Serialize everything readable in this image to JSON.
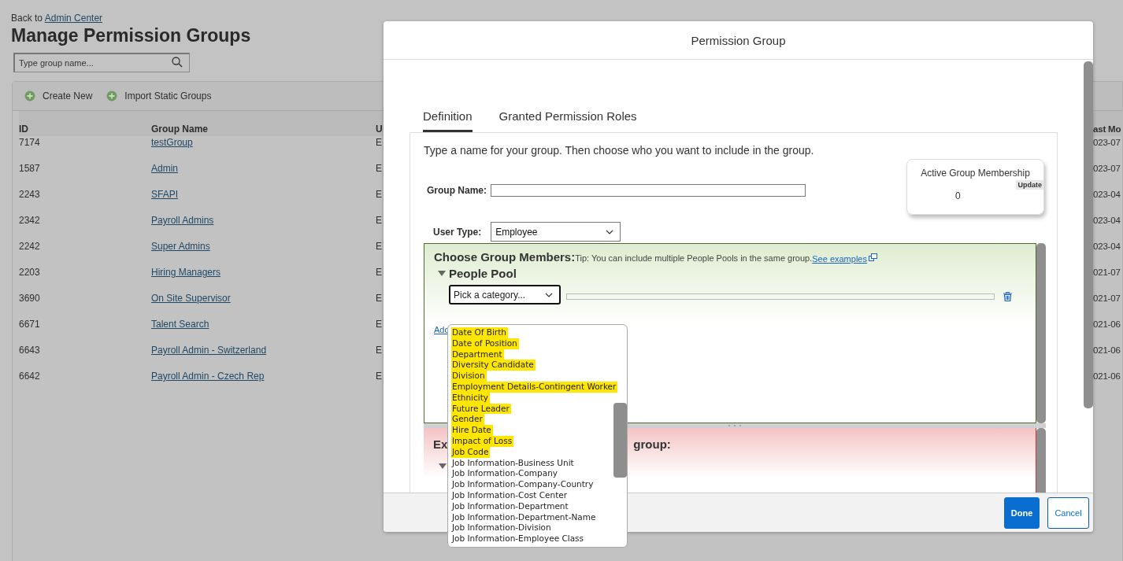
{
  "page": {
    "back_prefix": "Back to",
    "back_link": "Admin Center",
    "title": "Manage Permission Groups",
    "search": {
      "placeholder": "Type group name..."
    },
    "toolbar": [
      "Create New",
      "Import Static Groups"
    ],
    "table": {
      "columns": [
        "ID",
        "Group Name",
        "U",
        "ast Mo"
      ],
      "rows": [
        [
          "7174",
          "testGroup",
          "E",
          "023-07"
        ],
        [
          "1587",
          "Admin",
          "E",
          "023-07"
        ],
        [
          "2243",
          "SFAPI",
          "E",
          "023-04"
        ],
        [
          "2342",
          "Payroll Admins",
          "E",
          "023-04"
        ],
        [
          "2242",
          "Super Admins",
          "E",
          "023-04"
        ],
        [
          "2203",
          "Hiring Managers",
          "E",
          "021-07"
        ],
        [
          "3690",
          "On Site Supervisor",
          "E",
          "021-07"
        ],
        [
          "6671",
          "Talent Search",
          "E",
          "021-06"
        ],
        [
          "6643",
          "Payroll Admin - Switzerland",
          "E",
          "021-06"
        ],
        [
          "6642",
          "Payroll Admin - Czech Rep",
          "E",
          "021-06"
        ]
      ]
    }
  },
  "dialog": {
    "title": "Permission Group",
    "tabs": [
      {
        "label": "Definition",
        "selected": true
      },
      {
        "label": "Granted Permission Roles",
        "selected": false
      }
    ],
    "intro": "Type a name for your group. Then choose who you want to include in the group.",
    "membership": {
      "title": "Active Group Membership",
      "button": "Update",
      "count": "0"
    },
    "group_name": {
      "label": "Group Name:"
    },
    "user_type": {
      "label": "User Type:",
      "value": "Employee"
    },
    "members": {
      "title": "Choose Group Members:",
      "tip": "Tip: You can include multiple People Pools in the same group.",
      "tip_link": "See examples",
      "pool": {
        "title": "People Pool",
        "expanded": true,
        "category": "Pick a category..."
      },
      "add_link": "Add"
    },
    "exclude": {
      "title_start": "Ex",
      "title_end": "group:",
      "expanded": true
    },
    "buttons": [
      {
        "label": "Done",
        "kind": "primary"
      },
      {
        "label": "Cancel",
        "kind": "secondary"
      }
    ]
  },
  "dropdown": {
    "items": [
      {
        "label": "Date Of Birth",
        "highlighted": true
      },
      {
        "label": "Date of Position",
        "highlighted": true
      },
      {
        "label": "Department",
        "highlighted": true
      },
      {
        "label": "Diversity Candidate",
        "highlighted": true
      },
      {
        "label": "Division",
        "highlighted": true
      },
      {
        "label": "Employment Details-Contingent Worker",
        "highlighted": true
      },
      {
        "label": "Ethnicity",
        "highlighted": true
      },
      {
        "label": "Future Leader",
        "highlighted": true
      },
      {
        "label": "Gender",
        "highlighted": true
      },
      {
        "label": "Hire Date",
        "highlighted": true
      },
      {
        "label": "Impact of Loss",
        "highlighted": true
      },
      {
        "label": "Job Code",
        "highlighted": true
      },
      {
        "label": "Job Information-Business Unit",
        "highlighted": false
      },
      {
        "label": "Job Information-Company",
        "highlighted": false
      },
      {
        "label": "Job Information-Company-Country",
        "highlighted": false
      },
      {
        "label": "Job Information-Cost Center",
        "highlighted": false
      },
      {
        "label": "Job Information-Department",
        "highlighted": false
      },
      {
        "label": "Job Information-Department-Name",
        "highlighted": false
      },
      {
        "label": "Job Information-Division",
        "highlighted": false
      },
      {
        "label": "Job Information-Employee Class",
        "highlighted": false
      }
    ]
  }
}
